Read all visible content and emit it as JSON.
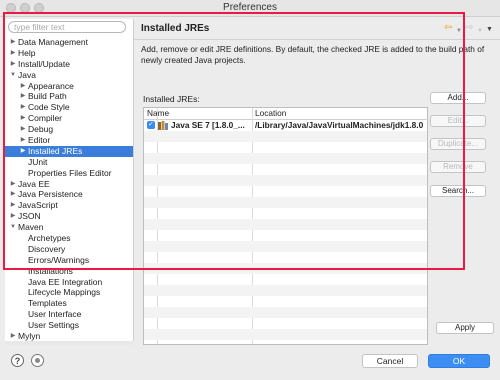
{
  "window": {
    "title": "Preferences"
  },
  "sidebar": {
    "filter_placeholder": "type filter text",
    "tree": [
      {
        "label": "Data Management",
        "level": 0,
        "arrow": "right"
      },
      {
        "label": "Help",
        "level": 0,
        "arrow": "right"
      },
      {
        "label": "Install/Update",
        "level": 0,
        "arrow": "right"
      },
      {
        "label": "Java",
        "level": 0,
        "arrow": "down"
      },
      {
        "label": "Appearance",
        "level": 1,
        "arrow": "right"
      },
      {
        "label": "Build Path",
        "level": 1,
        "arrow": "right"
      },
      {
        "label": "Code Style",
        "level": 1,
        "arrow": "right"
      },
      {
        "label": "Compiler",
        "level": 1,
        "arrow": "right"
      },
      {
        "label": "Debug",
        "level": 1,
        "arrow": "right"
      },
      {
        "label": "Editor",
        "level": 1,
        "arrow": "right"
      },
      {
        "label": "Installed JREs",
        "level": 1,
        "arrow": "right",
        "selected": true
      },
      {
        "label": "JUnit",
        "level": 1,
        "arrow": "none"
      },
      {
        "label": "Properties Files Editor",
        "level": 1,
        "arrow": "none"
      },
      {
        "label": "Java EE",
        "level": 0,
        "arrow": "right"
      },
      {
        "label": "Java Persistence",
        "level": 0,
        "arrow": "right"
      },
      {
        "label": "JavaScript",
        "level": 0,
        "arrow": "right"
      },
      {
        "label": "JSON",
        "level": 0,
        "arrow": "right"
      },
      {
        "label": "Maven",
        "level": 0,
        "arrow": "down"
      },
      {
        "label": "Archetypes",
        "level": 1,
        "arrow": "none"
      },
      {
        "label": "Discovery",
        "level": 1,
        "arrow": "none"
      },
      {
        "label": "Errors/Warnings",
        "level": 1,
        "arrow": "none"
      },
      {
        "label": "Installations",
        "level": 1,
        "arrow": "none"
      },
      {
        "label": "Java EE Integration",
        "level": 1,
        "arrow": "none"
      },
      {
        "label": "Lifecycle Mappings",
        "level": 1,
        "arrow": "none"
      },
      {
        "label": "Templates",
        "level": 1,
        "arrow": "none"
      },
      {
        "label": "User Interface",
        "level": 1,
        "arrow": "none"
      },
      {
        "label": "User Settings",
        "level": 1,
        "arrow": "none"
      },
      {
        "label": "Mylyn",
        "level": 0,
        "arrow": "right"
      },
      {
        "label": "Oomph",
        "level": 0,
        "arrow": "right"
      }
    ]
  },
  "page": {
    "title": "Installed JREs",
    "description": "Add, remove or edit JRE definitions. By default, the checked JRE is added to the build path of newly created Java projects.",
    "table_label": "Installed JREs:",
    "columns": {
      "name": "Name",
      "location": "Location"
    },
    "rows": [
      {
        "checked": true,
        "name": "Java SE 7 [1.8.0_...",
        "location": "/Library/Java/JavaVirtualMachines/jdk1.8.0"
      }
    ],
    "buttons": {
      "add": "Add...",
      "edit": "Edit...",
      "duplicate": "Duplicate...",
      "remove": "Remove",
      "search": "Search..."
    },
    "apply": "Apply"
  },
  "footer": {
    "cancel": "Cancel",
    "ok": "OK"
  },
  "colors": {
    "accent": "#3b7ddb",
    "ok_button": "#3d8ef2",
    "annotation_border": "#ec1a42",
    "nav_back": "#e8a31a"
  },
  "icons": {
    "nav_back": "back-arrow-icon",
    "nav_forward": "forward-arrow-icon",
    "menu": "view-menu-icon",
    "help": "help-icon",
    "settings": "preferences-settings-icon",
    "jre": "java-jre-icon",
    "tree_expand": "chevron-right-icon",
    "tree_collapse": "chevron-down-icon"
  }
}
